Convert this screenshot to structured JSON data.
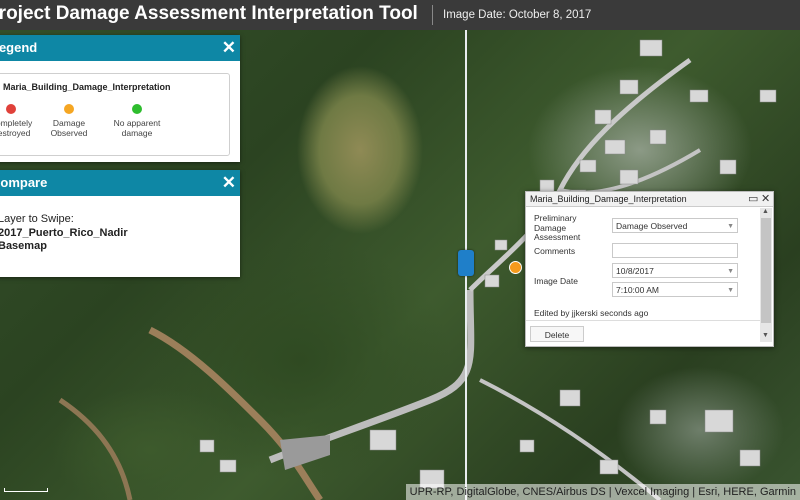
{
  "header": {
    "title": "Project Damage Assessment Interpretation Tool",
    "image_date": "Image Date: October 8, 2017"
  },
  "legend_panel": {
    "title": "Legend",
    "close_icon": "close-icon",
    "layer_name": "Maria_Building_Damage_Interpretation",
    "items": [
      {
        "label_line1": "Completely",
        "label_line2": "Destroyed",
        "color": "#e0413a"
      },
      {
        "label_line1": "Damage",
        "label_line2": "Observed",
        "color": "#f5a623"
      },
      {
        "label_line1": "No apparent",
        "label_line2": "damage",
        "color": "#2ebd2e"
      }
    ]
  },
  "compare_panel": {
    "title": "Compare",
    "close_icon": "close-icon",
    "swipe_label": "Layer to Swipe:",
    "swipe_layer": "2017_Puerto_Rico_Nadir",
    "swipe_layer_line2": "Basemap"
  },
  "popup": {
    "title": "Maria_Building_Damage_Interpretation",
    "fields": [
      {
        "label": "Preliminary Damage Assessment",
        "value": "Damage Observed",
        "type": "select"
      },
      {
        "label": "Comments",
        "value": "",
        "type": "text"
      },
      {
        "label": "Image Date",
        "value": "10/8/2017",
        "type": "select"
      },
      {
        "label": "",
        "value": "7:10:00 AM",
        "type": "select"
      }
    ],
    "edited": "Edited by jjkerski seconds ago",
    "delete_label": "Delete"
  },
  "map": {
    "attribution": "UPR-RP, DigitalGlobe, CNES/Airbus DS | Vexcel Imaging | Esri, HERE, Garmin"
  },
  "colors": {
    "header_bg": "#3a3a3a",
    "panel_accent": "#0e87a5",
    "swipe_handle": "#1f7fc9",
    "damage_marker": "#f59a1c"
  }
}
